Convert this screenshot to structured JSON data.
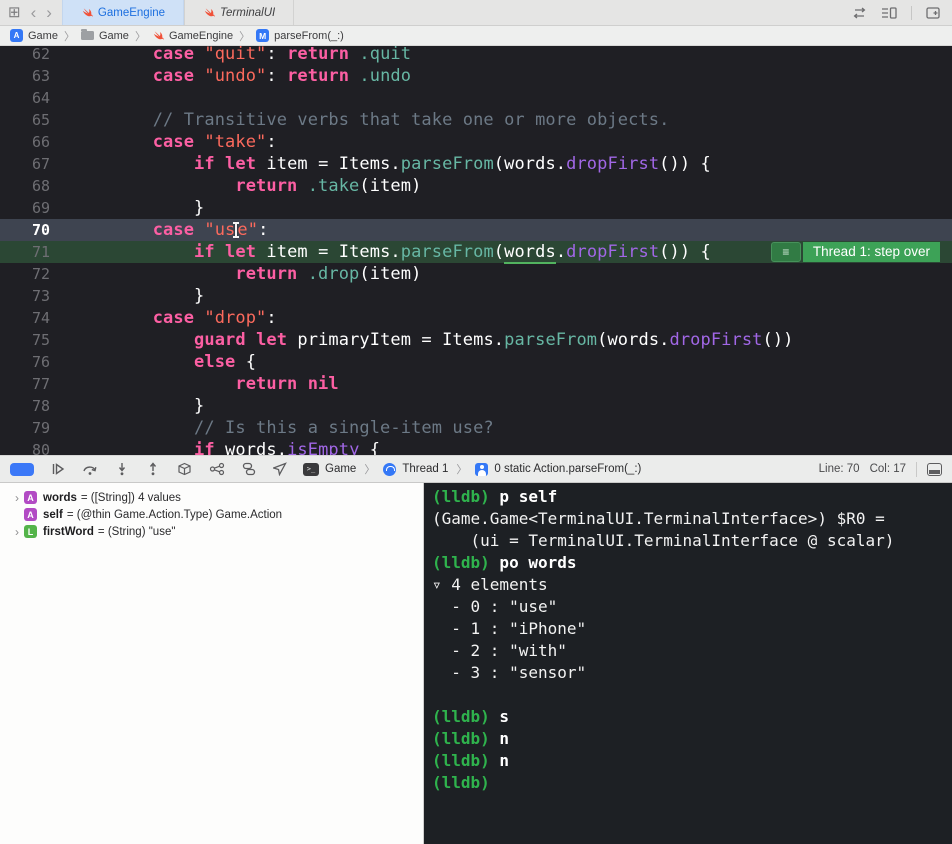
{
  "window": {
    "tabs": [
      {
        "label": "GameEngine",
        "active": true
      },
      {
        "label": "TerminalUI",
        "active": false
      }
    ]
  },
  "breadcrumbs": {
    "project": "Game",
    "folder": "Game",
    "file": "GameEngine",
    "symbol": "parseFrom(_:)",
    "app_badge_letter": "A",
    "method_badge_letter": "M"
  },
  "editor": {
    "lines": [
      {
        "num": "62",
        "tokens": [
          [
            "pln",
            "        "
          ],
          [
            "kw",
            "case"
          ],
          [
            "pln",
            " "
          ],
          [
            "str",
            "\"quit\""
          ],
          [
            "pln",
            ": "
          ],
          [
            "kw",
            "return"
          ],
          [
            "pln",
            " "
          ],
          [
            "mem",
            ".quit"
          ]
        ]
      },
      {
        "num": "63",
        "tokens": [
          [
            "pln",
            "        "
          ],
          [
            "kw",
            "case"
          ],
          [
            "pln",
            " "
          ],
          [
            "str",
            "\"undo\""
          ],
          [
            "pln",
            ": "
          ],
          [
            "kw",
            "return"
          ],
          [
            "pln",
            " "
          ],
          [
            "mem",
            ".undo"
          ]
        ]
      },
      {
        "num": "64",
        "tokens": []
      },
      {
        "num": "65",
        "tokens": [
          [
            "pln",
            "        "
          ],
          [
            "com",
            "// Transitive verbs that take one or more objects."
          ]
        ]
      },
      {
        "num": "66",
        "tokens": [
          [
            "pln",
            "        "
          ],
          [
            "kw",
            "case"
          ],
          [
            "pln",
            " "
          ],
          [
            "str",
            "\"take\""
          ],
          [
            "pln",
            ":"
          ]
        ]
      },
      {
        "num": "67",
        "tokens": [
          [
            "pln",
            "            "
          ],
          [
            "kw",
            "if"
          ],
          [
            "pln",
            " "
          ],
          [
            "kw",
            "let"
          ],
          [
            "pln",
            " item = Items."
          ],
          [
            "fn",
            "parseFrom"
          ],
          [
            "pln",
            "(words."
          ],
          [
            "sys",
            "dropFirst"
          ],
          [
            "pln",
            "()) {"
          ]
        ]
      },
      {
        "num": "68",
        "tokens": [
          [
            "pln",
            "                "
          ],
          [
            "kw",
            "return"
          ],
          [
            "pln",
            " "
          ],
          [
            "mem",
            ".take"
          ],
          [
            "pln",
            "(item)"
          ]
        ]
      },
      {
        "num": "69",
        "tokens": [
          [
            "pln",
            "            }"
          ]
        ]
      },
      {
        "num": "70",
        "highlight": "sel",
        "tokens": [
          [
            "pln",
            "        "
          ],
          [
            "kw",
            "case"
          ],
          [
            "pln",
            " "
          ],
          [
            "str",
            "\"us"
          ],
          [
            "cursor",
            ""
          ],
          [
            "str",
            "e\""
          ],
          [
            "pln",
            ":"
          ]
        ]
      },
      {
        "num": "71",
        "highlight": "dbg",
        "badge": {
          "menu": "≡",
          "label": "Thread 1: step over"
        },
        "tokens": [
          [
            "pln",
            "            "
          ],
          [
            "kw",
            "if"
          ],
          [
            "pln",
            " "
          ],
          [
            "kw",
            "let"
          ],
          [
            "pln",
            " item = Items."
          ],
          [
            "fn",
            "parseFrom"
          ],
          [
            "pln",
            "("
          ],
          [
            "u",
            "words"
          ],
          [
            "pln",
            "."
          ],
          [
            "sys",
            "dropFirst"
          ],
          [
            "pln",
            "()) {"
          ]
        ]
      },
      {
        "num": "72",
        "tokens": [
          [
            "pln",
            "                "
          ],
          [
            "kw",
            "return"
          ],
          [
            "pln",
            " "
          ],
          [
            "mem",
            ".drop"
          ],
          [
            "pln",
            "(item)"
          ]
        ]
      },
      {
        "num": "73",
        "tokens": [
          [
            "pln",
            "            }"
          ]
        ]
      },
      {
        "num": "74",
        "tokens": [
          [
            "pln",
            "        "
          ],
          [
            "kw",
            "case"
          ],
          [
            "pln",
            " "
          ],
          [
            "str",
            "\"drop\""
          ],
          [
            "pln",
            ":"
          ]
        ]
      },
      {
        "num": "75",
        "tokens": [
          [
            "pln",
            "            "
          ],
          [
            "kw",
            "guard"
          ],
          [
            "pln",
            " "
          ],
          [
            "kw",
            "let"
          ],
          [
            "pln",
            " primaryItem = Items."
          ],
          [
            "fn",
            "parseFrom"
          ],
          [
            "pln",
            "(words."
          ],
          [
            "sys",
            "dropFirst"
          ],
          [
            "pln",
            "())"
          ]
        ]
      },
      {
        "num": "76",
        "tokens": [
          [
            "pln",
            "            "
          ],
          [
            "kw",
            "else"
          ],
          [
            "pln",
            " {"
          ]
        ]
      },
      {
        "num": "77",
        "tokens": [
          [
            "pln",
            "                "
          ],
          [
            "kw",
            "return"
          ],
          [
            "pln",
            " "
          ],
          [
            "kw",
            "nil"
          ]
        ]
      },
      {
        "num": "78",
        "tokens": [
          [
            "pln",
            "            }"
          ]
        ]
      },
      {
        "num": "79",
        "tokens": [
          [
            "pln",
            "            "
          ],
          [
            "com",
            "// Is this a single-item use?"
          ]
        ]
      },
      {
        "num": "80",
        "tokens": [
          [
            "pln",
            "            "
          ],
          [
            "kw",
            "if"
          ],
          [
            "pln",
            " words."
          ],
          [
            "sys",
            "isEmpty"
          ],
          [
            "pln",
            " {"
          ]
        ]
      }
    ]
  },
  "debugbar": {
    "process": "Game",
    "thread": "Thread 1",
    "frame": "0 static Action.parseFrom(_:)",
    "line_label": "Line: 70",
    "col_label": "Col: 17",
    "terminal_glyph": ">_"
  },
  "variables": [
    {
      "chevron": "›",
      "badge": "A",
      "badge_color": "purple",
      "name": "words",
      "value": "= ([String]) 4 values"
    },
    {
      "chevron": "",
      "badge": "A",
      "badge_color": "purple",
      "name": "self",
      "value": "= (@thin Game.Action.Type) Game.Action"
    },
    {
      "chevron": "›",
      "badge": "L",
      "badge_color": "green",
      "name": "firstWord",
      "value": "= (String) \"use\""
    }
  ],
  "console": {
    "lines": [
      {
        "prompt": "(lldb)",
        "cmd": "p self"
      },
      {
        "out": "(Game.Game<TerminalUI.TerminalInterface>) $R0 ="
      },
      {
        "out": "    (ui = TerminalUI.TerminalInterface @ scalar)"
      },
      {
        "prompt": "(lldb)",
        "cmd": "po words"
      },
      {
        "out": "▿ 4 elements"
      },
      {
        "out": "  - 0 : \"use\""
      },
      {
        "out": "  - 1 : \"iPhone\""
      },
      {
        "out": "  - 2 : \"with\""
      },
      {
        "out": "  - 3 : \"sensor\""
      },
      {
        "out": ""
      },
      {
        "prompt": "(lldb)",
        "cmd": "s"
      },
      {
        "prompt": "(lldb)",
        "cmd": "n"
      },
      {
        "prompt": "(lldb)",
        "cmd": "n"
      },
      {
        "prompt": "(lldb)",
        "cmd": ""
      }
    ]
  },
  "colors": {
    "accent_blue": "#3478f6",
    "debug_green_row": "#2b4734",
    "debug_green_badge": "#3da257",
    "lldb_green": "#2fb34d",
    "keyword_pink": "#fc5fa3",
    "string_red": "#fc6a5d"
  }
}
